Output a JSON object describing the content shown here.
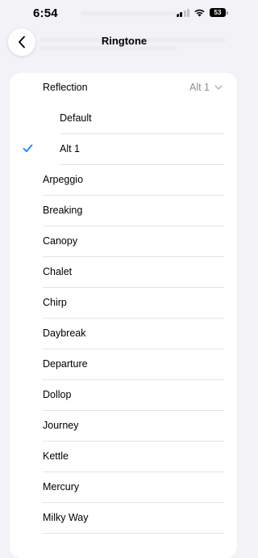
{
  "status_bar": {
    "time": "6:54",
    "battery": "53",
    "icons": [
      "signal-icon",
      "wifi-icon",
      "battery-icon"
    ]
  },
  "nav": {
    "title": "Ringtone",
    "back_icon": "chevron-left-icon"
  },
  "ringtones": {
    "group": {
      "name": "Reflection",
      "selected": "Alt 1",
      "variants": [
        "Default",
        "Alt 1"
      ],
      "checked_variant": "Alt 1"
    },
    "items": [
      "Arpeggio",
      "Breaking",
      "Canopy",
      "Chalet",
      "Chirp",
      "Daybreak",
      "Departure",
      "Dollop",
      "Journey",
      "Kettle",
      "Mercury",
      "Milky Way"
    ]
  },
  "colors": {
    "accent": "#0a84ff",
    "background": "#f2f2f7",
    "secondary_text": "#8e8e93"
  }
}
